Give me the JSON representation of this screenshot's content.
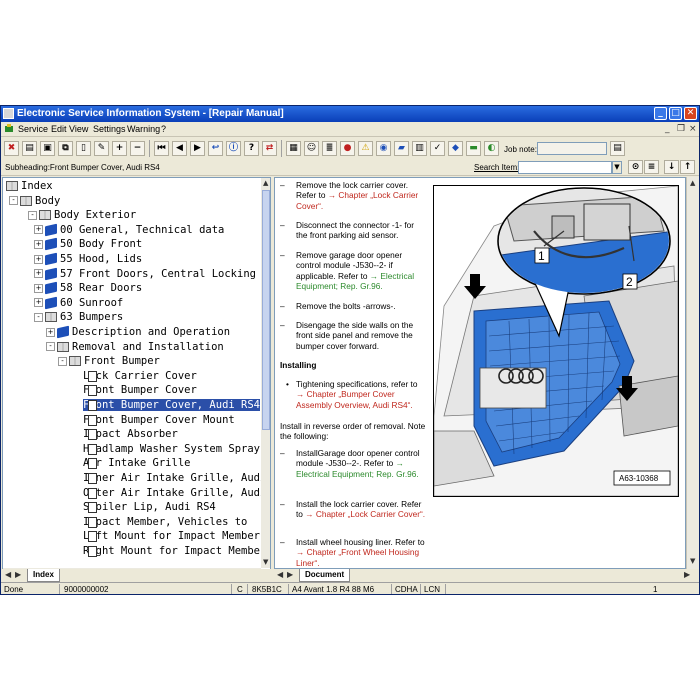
{
  "window": {
    "title": "Electronic Service Information System - [Repair Manual]",
    "controls": {
      "minimize": "_",
      "maximize": "□",
      "close": "✕"
    }
  },
  "menu": {
    "items": [
      "Service",
      "Edit",
      "View",
      "Settings",
      "Warning",
      "?"
    ],
    "doc_controls": {
      "minimize": "_",
      "restore": "❐",
      "close": "×"
    }
  },
  "toolbar": {
    "job_note_label": "Job note:",
    "job_note_value": ""
  },
  "subheading": "Subheading:Front Bumper Cover, Audi RS4",
  "search": {
    "label": "Search Item:",
    "value": ""
  },
  "tree": {
    "nodes": [
      {
        "label": "Index",
        "icon": "bookopen",
        "exp": ""
      },
      {
        "label": "Body",
        "icon": "bookopen",
        "exp": "-"
      },
      {
        "label": "Body Exterior",
        "icon": "bookopen",
        "exp": "-"
      },
      {
        "label": "00 General, Technical data",
        "icon": "book",
        "exp": "+"
      },
      {
        "label": "50 Body Front",
        "icon": "book",
        "exp": "+"
      },
      {
        "label": "55 Hood, Lids",
        "icon": "book",
        "exp": "+"
      },
      {
        "label": "57 Front Doors, Central Locking",
        "icon": "book",
        "exp": "+"
      },
      {
        "label": "58 Rear Doors",
        "icon": "book",
        "exp": "+"
      },
      {
        "label": "60 Sunroof",
        "icon": "book",
        "exp": "+"
      },
      {
        "label": "63 Bumpers",
        "icon": "bookopen",
        "exp": "-"
      },
      {
        "label": "Description and Operation",
        "icon": "book",
        "exp": "+"
      },
      {
        "label": "Removal and Installation",
        "icon": "bookopen",
        "exp": "-"
      },
      {
        "label": "Front Bumper",
        "icon": "bookopen",
        "exp": "-"
      },
      {
        "label": "Lock Carrier Cover",
        "icon": "doc",
        "exp": ""
      },
      {
        "label": "Front Bumper Cover",
        "icon": "doc",
        "exp": ""
      },
      {
        "label": "Front Bumper Cover, Audi RS4",
        "icon": "doc",
        "exp": "",
        "selected": true
      },
      {
        "label": "Front Bumper Cover Mount",
        "icon": "doc",
        "exp": ""
      },
      {
        "label": "Impact Absorber",
        "icon": "doc",
        "exp": ""
      },
      {
        "label": "Headlamp Washer System Spray",
        "icon": "doc",
        "exp": ""
      },
      {
        "label": "Air Intake Grille",
        "icon": "doc",
        "exp": ""
      },
      {
        "label": "Inner Air Intake Grille, Audi",
        "icon": "doc",
        "exp": ""
      },
      {
        "label": "Outer Air Intake Grille, Audi",
        "icon": "doc",
        "exp": ""
      },
      {
        "label": "Spoiler Lip, Audi RS4",
        "icon": "doc",
        "exp": ""
      },
      {
        "label": "Impact Member, Vehicles to",
        "icon": "doc",
        "exp": ""
      },
      {
        "label": "Left Mount for Impact Member",
        "icon": "doc",
        "exp": ""
      },
      {
        "label": "Right Mount for Impact Member",
        "icon": "doc",
        "exp": ""
      }
    ],
    "tab_label": "Index"
  },
  "document": {
    "steps_top": [
      {
        "mark": "–",
        "text": "Remove the lock carrier cover. Refer to ",
        "link": "→ Chapter „Lock Carrier Cover“.",
        "link_color": "red"
      },
      {
        "mark": "–",
        "text": "Disconnect the connector -1- for the front parking aid sensor.",
        "link": ""
      },
      {
        "mark": "–",
        "text": "Remove garage door opener control module -J530--2- if applicable. Refer to ",
        "link": "→ Electrical Equipment; Rep. Gr.96.",
        "link_color": "green"
      },
      {
        "mark": "–",
        "text": "Remove the bolts -arrows-.",
        "link": ""
      },
      {
        "mark": "–",
        "text": "Disengage the side walls on the front side panel and remove the bumper cover forward.",
        "link": ""
      }
    ],
    "installing_heading": "Installing",
    "bullet": {
      "mark": "•",
      "text": "Tightening specifications, refer to ",
      "link": "→ Chapter „Bumper Cover Assembly Overview, Audi RS4“."
    },
    "install_note": "Install in reverse order of removal. Note the following:",
    "steps_bottom": [
      {
        "mark": "–",
        "text": "InstallGarage door opener control module -J530--2-. Refer to ",
        "link": "→ Electrical Equipment; Rep. Gr.96.",
        "link_color": "green"
      },
      {
        "mark": "–",
        "text": "Install the lock carrier cover. Refer to ",
        "link": "→ Chapter „Lock Carrier Cover“.",
        "link_color": "red"
      },
      {
        "mark": "–",
        "text": "Install wheel housing liner. Refer to ",
        "link": "→ Chapter „Front Wheel Housing Liner“.",
        "link_color": "red"
      }
    ],
    "figure": {
      "callouts": [
        "1",
        "2"
      ],
      "code": "A63-10368"
    },
    "tab_label": "Document"
  },
  "status": {
    "state": "Done",
    "number": "9000000002",
    "c": "C",
    "code": "8K5B1C",
    "model": "A4 Avant 1.8 R4 88 M6",
    "engine": "CDHA",
    "trans": "LCN",
    "page": "1"
  },
  "colors": {
    "title_bar": "#0a3fb8",
    "selection": "#2b4fa8",
    "link_red": "#c0281e",
    "link_green": "#2c8a2c",
    "car_blue": "#2a6fd0"
  }
}
